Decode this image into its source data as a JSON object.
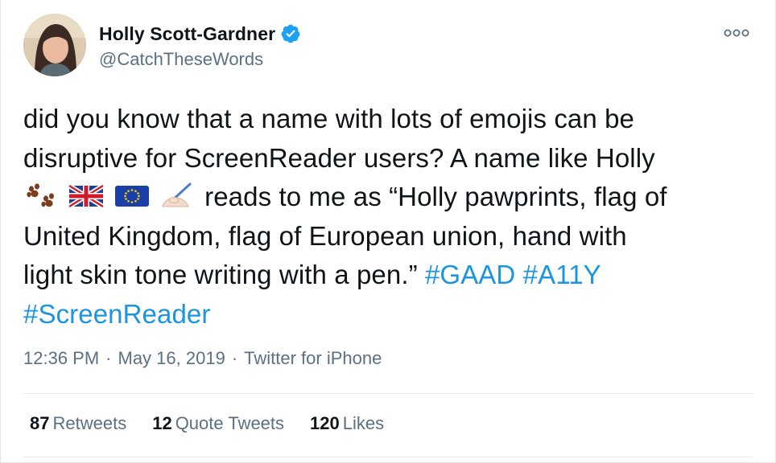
{
  "author": {
    "display_name": "Holly Scott-Gardner",
    "handle": "@CatchTheseWords",
    "verified_color": "#1da1f2"
  },
  "tweet": {
    "line1": "did you know that a name with lots of emojis can be",
    "line2": "disruptive for ScreenReader users? A name like Holly",
    "line3_emojis": [
      "paw-prints-emoji",
      "uk-flag-emoji",
      "eu-flag-emoji",
      "writing-hand-emoji"
    ],
    "line3_text": "reads to me as “Holly pawprints, flag of",
    "line4": "United Kingdom, flag of European union, hand with",
    "line5": "light skin tone writing with a pen.”",
    "hashtags": [
      "#GAAD",
      "#A11Y",
      "#ScreenReader"
    ]
  },
  "meta": {
    "time": "12:36 PM",
    "separator": "·",
    "date": "May 16, 2019",
    "source": "Twitter for iPhone"
  },
  "stats": {
    "retweets_count": "87",
    "retweets_label": "Retweets",
    "quote_count": "12",
    "quote_label": "Quote Tweets",
    "likes_count": "120",
    "likes_label": "Likes"
  },
  "colors": {
    "hashtag": "#1b95e0",
    "secondary_text": "#5b7083",
    "primary_text": "#0f1419"
  }
}
